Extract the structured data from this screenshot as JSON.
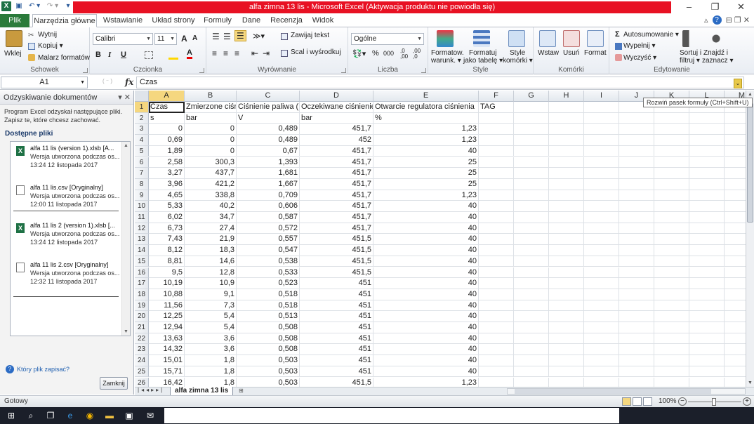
{
  "titlebar": {
    "title": "alfa zimna 13 lis  -  Microsoft Excel (Aktywacja produktu nie powiodła się)",
    "minimize": "–",
    "restore": "❐",
    "close": "✕"
  },
  "qat": {
    "save_icon": "save-icon",
    "undo": "↶ ▾",
    "redo": "↷ ▾",
    "customize": "▾"
  },
  "tabs": {
    "file": "Plik",
    "items": [
      "Narzędzia główne",
      "Wstawianie",
      "Układ strony",
      "Formuły",
      "Dane",
      "Recenzja",
      "Widok"
    ],
    "active_index": 0,
    "right_icons": "⌃ ⌄ ⊟ ✕"
  },
  "ribbon": {
    "clipboard": {
      "paste": "Wklej",
      "cut": "Wytnij",
      "copy": "Kopiuj ▾",
      "painter": "Malarz formatów",
      "label": "Schowek"
    },
    "font": {
      "name": "Calibri",
      "size": "11",
      "grow": "A",
      "shrink": "A",
      "bold": "B",
      "italic": "I",
      "underline": "U",
      "label": "Czcionka"
    },
    "alignment": {
      "wrap": "Zawijaj tekst",
      "merge": "Scal i wyśrodkuj",
      "label": "Wyrównanie"
    },
    "number": {
      "format": "Ogólne",
      "percent": "%",
      "thousands": "000",
      "inc": ",0 ,00",
      "dec": ",00 ,0",
      "label": "Liczba"
    },
    "styles": {
      "cond": "Formatow.",
      "cond2": "warunk. ▾",
      "table": "Formatuj",
      "table2": "jako tabelę ▾",
      "cell": "Style",
      "cell2": "komórki ▾",
      "label": "Style"
    },
    "cells": {
      "insert": "Wstaw",
      "delete": "Usuń",
      "format": "Format",
      "label": "Komórki"
    },
    "editing": {
      "autosum": "Autosumowanie ▾",
      "fill": "Wypełnij ▾",
      "clear": "Wyczyść ▾",
      "sort": "Sortuj i",
      "sort2": "filtruj ▾",
      "find": "Znajdź i",
      "find2": "zaznacz ▾",
      "label": "Edytowanie"
    }
  },
  "formula_bar": {
    "name_box": "A1",
    "fx": "fx",
    "content": "Czas",
    "tooltip": "Rozwiń pasek formuły (Ctrl+Shift+U)"
  },
  "recovery": {
    "title": "Odzyskiwanie dokumentów",
    "info": "Program Excel odzyskał następujące pliki. Zapisz te, które chcesz zachować.",
    "available": "Dostępne pliki",
    "files": [
      {
        "name": "alfa 11 lis (version 1).xlsb  [A...",
        "desc": "Wersja utworzona podczas os...",
        "time": "13:24 12 listopada 2017",
        "type": "xlsb"
      },
      {
        "name": "alfa 11 lis.csv  [Oryginalny]",
        "desc": "Wersja utworzona podczas os...",
        "time": "12:00 11 listopada 2017",
        "type": "csv"
      },
      {
        "name": "alfa 11 lis 2 (version 1).xlsb  [...",
        "desc": "Wersja utworzona podczas os...",
        "time": "13:24 12 listopada 2017",
        "type": "xlsb"
      },
      {
        "name": "alfa 11 lis 2.csv  [Oryginalny]",
        "desc": "Wersja utworzona podczas os...",
        "time": "12:32 11 listopada 2017",
        "type": "csv"
      }
    ],
    "help": "Który plik zapisać?",
    "close_button": "Zamknij"
  },
  "sheet": {
    "columns": [
      "A",
      "B",
      "C",
      "D",
      "E",
      "F",
      "G",
      "H",
      "I",
      "J",
      "K",
      "L",
      "M"
    ],
    "header_row": [
      "Czas",
      "Zmierzone ciśn",
      "Ciśnienie paliwa (",
      "Oczekiwane ciśnienie",
      "Otwarcie regulatora ciśnienia",
      "TAG"
    ],
    "unit_row": [
      "s",
      "bar",
      "V",
      "bar",
      "%",
      ""
    ],
    "data": [
      [
        "0",
        "0",
        "0,489",
        "451,7",
        "1,23"
      ],
      [
        "0,69",
        "0",
        "0,489",
        "452",
        "1,23"
      ],
      [
        "1,89",
        "0",
        "0,67",
        "451,7",
        "40"
      ],
      [
        "2,58",
        "300,3",
        "1,393",
        "451,7",
        "25"
      ],
      [
        "3,27",
        "437,7",
        "1,681",
        "451,7",
        "25"
      ],
      [
        "3,96",
        "421,2",
        "1,667",
        "451,7",
        "25"
      ],
      [
        "4,65",
        "338,8",
        "0,709",
        "451,7",
        "1,23"
      ],
      [
        "5,33",
        "40,2",
        "0,606",
        "451,7",
        "40"
      ],
      [
        "6,02",
        "34,7",
        "0,587",
        "451,7",
        "40"
      ],
      [
        "6,73",
        "27,4",
        "0,572",
        "451,7",
        "40"
      ],
      [
        "7,43",
        "21,9",
        "0,557",
        "451,5",
        "40"
      ],
      [
        "8,12",
        "18,3",
        "0,547",
        "451,5",
        "40"
      ],
      [
        "8,81",
        "14,6",
        "0,538",
        "451,5",
        "40"
      ],
      [
        "9,5",
        "12,8",
        "0,533",
        "451,5",
        "40"
      ],
      [
        "10,19",
        "10,9",
        "0,523",
        "451",
        "40"
      ],
      [
        "10,88",
        "9,1",
        "0,518",
        "451",
        "40"
      ],
      [
        "11,56",
        "7,3",
        "0,518",
        "451",
        "40"
      ],
      [
        "12,25",
        "5,4",
        "0,513",
        "451",
        "40"
      ],
      [
        "12,94",
        "5,4",
        "0,508",
        "451",
        "40"
      ],
      [
        "13,63",
        "3,6",
        "0,508",
        "451",
        "40"
      ],
      [
        "14,32",
        "3,6",
        "0,508",
        "451",
        "40"
      ],
      [
        "15,01",
        "1,8",
        "0,503",
        "451",
        "40"
      ],
      [
        "15,71",
        "1,8",
        "0,503",
        "451",
        "40"
      ],
      [
        "16,42",
        "1,8",
        "0,503",
        "451,5",
        "1,23"
      ]
    ],
    "tab_name": "alfa zimna 13 lis"
  },
  "status": {
    "ready": "Gotowy",
    "zoom": "100%"
  },
  "colors": {
    "accent_red": "#e81123",
    "file_tab": "#2a7a3a",
    "selection": "#f5d77f"
  }
}
